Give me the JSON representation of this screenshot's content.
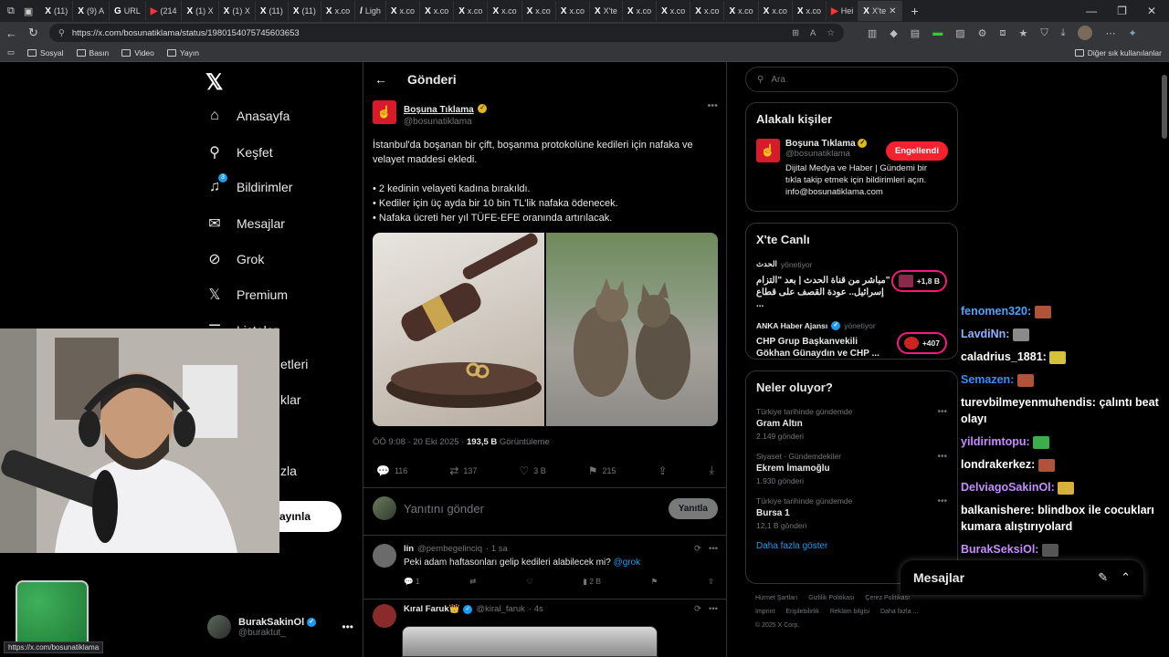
{
  "browser": {
    "tabs": [
      {
        "icon": "X",
        "label": "(11)"
      },
      {
        "icon": "X",
        "label": "(9) A"
      },
      {
        "icon": "G",
        "label": "URL"
      },
      {
        "icon": "▶",
        "label": "(214"
      },
      {
        "icon": "X",
        "label": "(1) X"
      },
      {
        "icon": "X",
        "label": "(1) X"
      },
      {
        "icon": "X",
        "label": "(11)"
      },
      {
        "icon": "X",
        "label": "(11)"
      },
      {
        "icon": "X",
        "label": "x.co"
      },
      {
        "icon": "/",
        "label": "Ligh"
      },
      {
        "icon": "X",
        "label": "x.co"
      },
      {
        "icon": "X",
        "label": "x.co"
      },
      {
        "icon": "X",
        "label": "x.co"
      },
      {
        "icon": "X",
        "label": "x.co"
      },
      {
        "icon": "X",
        "label": "x.co"
      },
      {
        "icon": "X",
        "label": "x.co"
      },
      {
        "icon": "X",
        "label": "X'te"
      },
      {
        "icon": "X",
        "label": "x.co"
      },
      {
        "icon": "X",
        "label": "x.co"
      },
      {
        "icon": "X",
        "label": "x.co"
      },
      {
        "icon": "X",
        "label": "x.co"
      },
      {
        "icon": "X",
        "label": "x.co"
      },
      {
        "icon": "X",
        "label": "x.co"
      },
      {
        "icon": "▶",
        "label": "Hei"
      },
      {
        "icon": "X",
        "label": "X'te"
      }
    ],
    "url": "https://x.com/bosunatiklama/status/1980154075745603653",
    "bookmarks": [
      "Sosyal",
      "Basın",
      "Video",
      "Yayın"
    ],
    "bookmarks_right": "Diğer sık kullanılanlar",
    "status_url": "https://x.com/bosunatiklama"
  },
  "nav": {
    "items": [
      {
        "label": "Anasayfa",
        "icon": "home-icon",
        "glyph": "⌂"
      },
      {
        "label": "Keşfet",
        "icon": "search-icon",
        "glyph": "⌕"
      },
      {
        "label": "Bildirimler",
        "icon": "bell-icon",
        "glyph": "🔔",
        "badge": "3"
      },
      {
        "label": "Mesajlar",
        "icon": "mail-icon",
        "glyph": "✉"
      },
      {
        "label": "Grok",
        "icon": "grok-icon",
        "glyph": "⊘"
      },
      {
        "label": "Premium",
        "icon": "x-premium-icon",
        "glyph": "𝕏"
      },
      {
        "label": "Listeler",
        "icon": "list-icon",
        "glyph": "☰"
      },
      {
        "label": "etleri",
        "icon": "bookmark-icon",
        "glyph": ""
      },
      {
        "label": "klar",
        "icon": "communities-icon",
        "glyph": ""
      },
      {
        "label": "zla",
        "icon": "more-icon",
        "glyph": ""
      }
    ],
    "post_button": "ayınla",
    "profile": {
      "name": "BurakSakinOl",
      "handle": "@buraktut_"
    }
  },
  "main": {
    "header_title": "Gönderi",
    "post": {
      "author": "Boşuna Tıklama",
      "handle": "@bosunatiklama",
      "text_intro": "İstanbul'da boşanan bir çift, boşanma protokolüne kedileri için nafaka ve velayet maddesi ekledi.",
      "bullets": [
        "• 2 kedinin velayeti kadına bırakıldı.",
        "• Kediler için üç ayda bir 10 bin TL'lik nafaka ödenecek.",
        "• Nafaka ücreti her yıl TÜFE-EFE oranında artırılacak."
      ],
      "time": "ÖÖ 9:08 · 20 Eki 2025 · ",
      "views": "193,5 B",
      "views_label": " Görüntüleme",
      "replies": "116",
      "reposts": "137",
      "likes": "3 B",
      "bookmarks": "215"
    },
    "reply_placeholder": "Yanıtını gönder",
    "reply_button": "Yanıtla",
    "replies": [
      {
        "name": "lin",
        "handle": "@pembegelinciq",
        "time": "· 1 sa",
        "text": "Peki adam haftasonları gelip kedileri alabilecek mi? ",
        "link": "@grok",
        "reply_count": "1",
        "views": "2 B"
      },
      {
        "name": "Kıral Faruk👑",
        "handle": "@kiral_faruk",
        "time": "· 4s"
      }
    ]
  },
  "sidebar": {
    "search_placeholder": "Ara",
    "related": {
      "title": "Alakalı kişiler",
      "name": "Boşuna Tıklama",
      "handle": "@bosunatiklama",
      "bio": "Dijital Medya ve Haber | Gündemi bir tıkla takip etmek için bildirimleri açın. info@bosunatiklama.com",
      "button": "Engellendi"
    },
    "live": {
      "title": "X'te Canlı",
      "items": [
        {
          "source": "الحدث",
          "role": "yönetiyor",
          "title": "\"مباشر من قناة الحدث | بعد \"التزام إسرائيل.. عودة القصف على قطاع ...",
          "count": "+1,8 B"
        },
        {
          "source": "ANKA Haber Ajansı",
          "role": "yönetiyor",
          "title": "CHP Grup Başkanvekili Gökhan Günaydın ve CHP ...",
          "count": "+407"
        }
      ]
    },
    "trends": {
      "title": "Neler oluyor?",
      "items": [
        {
          "category": "Türkiye tarihinde gündemde",
          "name": "Gram Altın",
          "count": "2.149 gönderi"
        },
        {
          "category": "Siyaset · Gündemdekiler",
          "name": "Ekrem İmamoğlu",
          "count": "1.930 gönderi"
        },
        {
          "category": "Türkiye tarihinde gündemde",
          "name": "Bursa 1",
          "count": "12,1 B gönderi"
        }
      ],
      "show_more": "Daha fazla göster"
    },
    "footer": [
      "Hizmet Şartları",
      "Gizlilik Politikası",
      "Çerez Politikası",
      "Imprint",
      "Erişilebilirlik",
      "Reklam bilgisi",
      "Daha fazla ...",
      "© 2025 X Corp."
    ]
  },
  "chat": [
    {
      "user": "fenomen320:",
      "msg": "",
      "color": "#4aa3ff"
    },
    {
      "user": "LavdiNn:",
      "msg": "",
      "color": "#8ab4ff"
    },
    {
      "user": "caladrius_1881:",
      "msg": "",
      "color": "#ffffff"
    },
    {
      "user": "Semazen:",
      "msg": "",
      "color": "#3b8cff"
    },
    {
      "user": "turevbilmeyenmuhendis:",
      "msg": "çalıntı beat olayı",
      "color": "#ffffff"
    },
    {
      "user": "yildirimtopu:",
      "msg": "",
      "color": "#c58cff"
    },
    {
      "user": "londrakerkez:",
      "msg": "",
      "color": "#ffffff"
    },
    {
      "user": "DelviagoSakinOl:",
      "msg": "",
      "color": "#c58cff"
    },
    {
      "user": "balkanishere:",
      "msg": "blindbox ile cocukları kumara alıştırıyolard",
      "color": "#ffffff"
    },
    {
      "user": "BurakSeksiOl:",
      "msg": "",
      "color": "#c58cff"
    }
  ],
  "messages_bar": {
    "title": "Mesajlar"
  },
  "colors": {
    "accent": "#1d9bf0",
    "danger": "#f4212e",
    "live": "#f91880"
  }
}
